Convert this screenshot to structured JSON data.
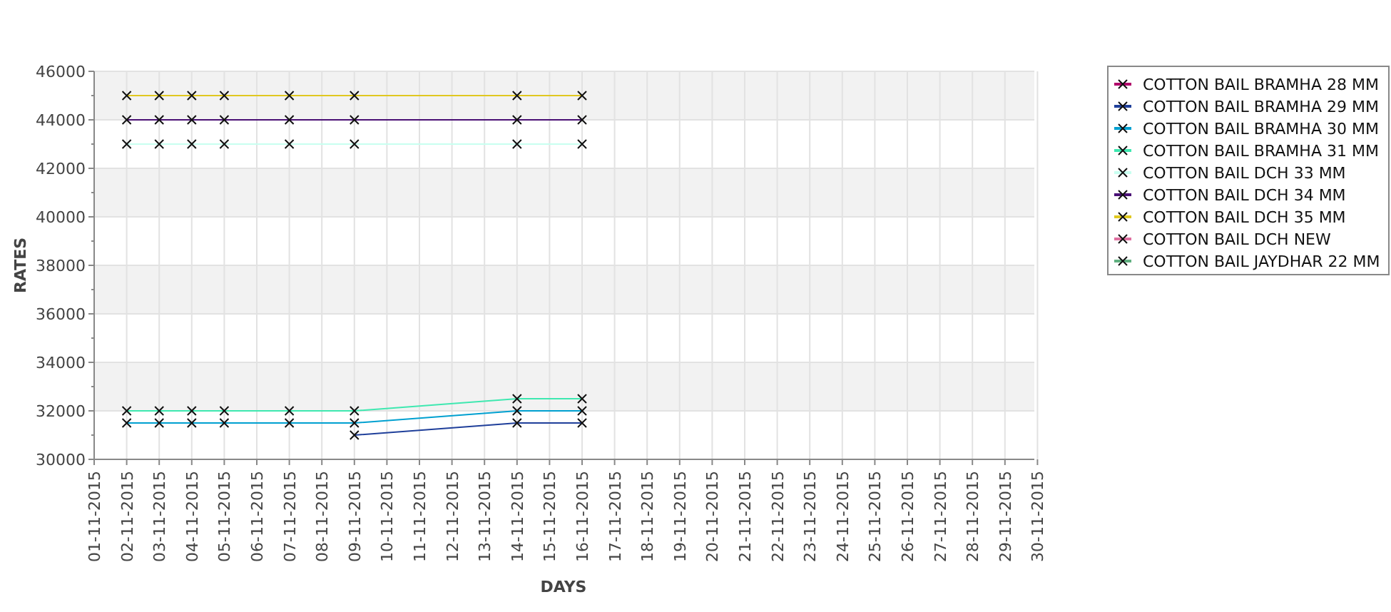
{
  "chart_data": {
    "type": "line",
    "xlabel": "DAYS",
    "ylabel": "RATES",
    "categories": [
      "01-11-2015",
      "02-11-2015",
      "03-11-2015",
      "04-11-2015",
      "05-11-2015",
      "06-11-2015",
      "07-11-2015",
      "08-11-2015",
      "09-11-2015",
      "10-11-2015",
      "11-11-2015",
      "12-11-2015",
      "13-11-2015",
      "14-11-2015",
      "15-11-2015",
      "16-11-2015",
      "17-11-2015",
      "18-11-2015",
      "19-11-2015",
      "20-11-2015",
      "21-11-2015",
      "22-11-2015",
      "23-11-2015",
      "24-11-2015",
      "25-11-2015",
      "26-11-2015",
      "27-11-2015",
      "28-11-2015",
      "29-11-2015",
      "30-11-2015"
    ],
    "ylim": [
      30000,
      46000
    ],
    "grid": true,
    "legend": true,
    "yticks": [
      30000,
      32000,
      34000,
      36000,
      38000,
      40000,
      42000,
      44000,
      46000
    ],
    "series": [
      {
        "name": "COTTON BAIL BRAMHA 28 MM",
        "color": "#b0006a",
        "marker": "x",
        "values": [
          null,
          null,
          null,
          null,
          null,
          null,
          null,
          null,
          null,
          null,
          null,
          null,
          null,
          null,
          null,
          null,
          null,
          null,
          null,
          null,
          null,
          null,
          null,
          null,
          null,
          null,
          null,
          null,
          null,
          null
        ]
      },
      {
        "name": "COTTON BAIL BRAMHA 29 MM",
        "color": "#1f3f9a",
        "marker": "x",
        "values": [
          null,
          null,
          null,
          null,
          null,
          null,
          null,
          null,
          31000,
          null,
          null,
          null,
          null,
          31500,
          null,
          31500,
          null,
          null,
          null,
          null,
          null,
          null,
          null,
          null,
          null,
          null,
          null,
          null,
          null,
          null
        ]
      },
      {
        "name": "COTTON BAIL BRAMHA 30 MM",
        "color": "#00a0d0",
        "marker": "x",
        "values": [
          null,
          31500,
          31500,
          31500,
          31500,
          null,
          31500,
          null,
          31500,
          null,
          null,
          null,
          null,
          32000,
          null,
          32000,
          null,
          null,
          null,
          null,
          null,
          null,
          null,
          null,
          null,
          null,
          null,
          null,
          null,
          null
        ]
      },
      {
        "name": "COTTON BAIL BRAMHA 31 MM",
        "color": "#3ee8b0",
        "marker": "x",
        "values": [
          null,
          32000,
          32000,
          32000,
          32000,
          null,
          32000,
          null,
          32000,
          null,
          null,
          null,
          null,
          32500,
          null,
          32500,
          null,
          null,
          null,
          null,
          null,
          null,
          null,
          null,
          null,
          null,
          null,
          null,
          null,
          null
        ]
      },
      {
        "name": "COTTON BAIL DCH 33 MM",
        "color": "#c8fff0",
        "marker": "x",
        "values": [
          null,
          43000,
          43000,
          43000,
          43000,
          null,
          43000,
          null,
          43000,
          null,
          null,
          null,
          null,
          43000,
          null,
          43000,
          null,
          null,
          null,
          null,
          null,
          null,
          null,
          null,
          null,
          null,
          null,
          null,
          null,
          null
        ]
      },
      {
        "name": "COTTON BAIL DCH 34 MM",
        "color": "#4a1075",
        "marker": "x",
        "values": [
          null,
          44000,
          44000,
          44000,
          44000,
          null,
          44000,
          null,
          44000,
          null,
          null,
          null,
          null,
          44000,
          null,
          44000,
          null,
          null,
          null,
          null,
          null,
          null,
          null,
          null,
          null,
          null,
          null,
          null,
          null,
          null
        ]
      },
      {
        "name": "COTTON BAIL DCH 35 MM",
        "color": "#e0c820",
        "marker": "x",
        "values": [
          null,
          45000,
          45000,
          45000,
          45000,
          null,
          45000,
          null,
          45000,
          null,
          null,
          null,
          null,
          45000,
          null,
          45000,
          null,
          null,
          null,
          null,
          null,
          null,
          null,
          null,
          null,
          null,
          null,
          null,
          null,
          null
        ]
      },
      {
        "name": "COTTON BAIL DCH NEW",
        "color": "#e070a0",
        "marker": "x",
        "values": [
          null,
          null,
          null,
          null,
          null,
          null,
          null,
          null,
          null,
          null,
          null,
          null,
          null,
          null,
          null,
          null,
          null,
          null,
          null,
          null,
          null,
          null,
          null,
          null,
          null,
          null,
          null,
          null,
          null,
          null
        ]
      },
      {
        "name": "COTTON BAIL JAYDHAR 22 MM",
        "color": "#60b080",
        "marker": "x",
        "values": [
          null,
          null,
          null,
          null,
          null,
          null,
          null,
          null,
          null,
          null,
          null,
          null,
          null,
          null,
          null,
          null,
          null,
          null,
          null,
          null,
          null,
          null,
          null,
          null,
          null,
          null,
          null,
          null,
          null,
          null
        ]
      }
    ]
  }
}
